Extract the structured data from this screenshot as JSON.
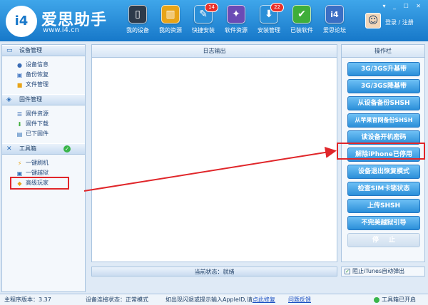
{
  "header": {
    "logo_text": "i4",
    "brand": "爱思助手",
    "url": "www.i4.cn",
    "nav": [
      {
        "label": "我的设备",
        "icon": "▯",
        "color": "#2d3a4a"
      },
      {
        "label": "我的资源",
        "icon": "▥",
        "color": "#e8a418"
      },
      {
        "label": "快捷安装",
        "icon": "✎",
        "color": "#2a8fd8",
        "badge": "14"
      },
      {
        "label": "软件资源",
        "icon": "✦",
        "color": "#6a4bb5"
      },
      {
        "label": "安装管理",
        "icon": "⬇",
        "color": "#2a8fd8",
        "badge": "22"
      },
      {
        "label": "已装软件",
        "icon": "✔",
        "color": "#3fae3a"
      },
      {
        "label": "爱思论坛",
        "icon": "i4",
        "color": "#3b6fc4"
      }
    ],
    "login": "登录 / 注册",
    "win_controls": "▾ _ ☐ ✕"
  },
  "sidebar": {
    "sections": [
      {
        "title": "设备管理",
        "items": [
          "设备信息",
          "备份恢复",
          "文件管理"
        ]
      },
      {
        "title": "固件管理",
        "items": [
          "固件资源",
          "固件下载",
          "已下固件"
        ]
      },
      {
        "title": "工具箱",
        "items": [
          "一键刷机",
          "一键越狱",
          "高级玩家"
        ]
      }
    ]
  },
  "log": {
    "title": "日志输出"
  },
  "status": {
    "label": "当前状态：就绪"
  },
  "tools": {
    "title": "操作栏",
    "buttons": [
      "3G/3GS升基带",
      "3G/3GS降基带",
      "从设备备份SHSH",
      "从苹果官网备份SHSH",
      "读设备开机密码",
      "解除iPhone已停用",
      "设备退出恢复模式",
      "检查SIM卡锁状态",
      "上传SHSH",
      "不完美越狱引导"
    ],
    "stop": "停止",
    "itunes_check": "阻止iTunes自动弹出"
  },
  "bottom": {
    "version": "主程序版本：3.37",
    "conn": "设备连接状态：正常模式",
    "hint_pre": "如出现闪退或提示输入AppleID,请",
    "hint_link": "点此修复",
    "feedback": "问题反馈",
    "toolbox_status": "工具箱已开启"
  }
}
